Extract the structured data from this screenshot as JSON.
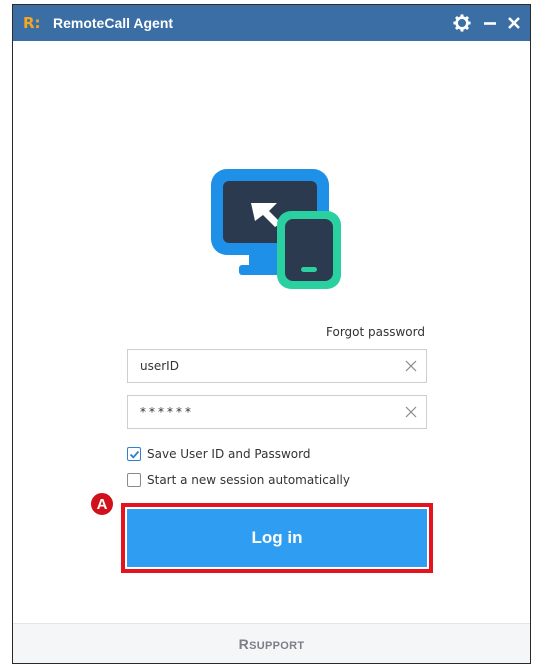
{
  "window": {
    "logo_text": "R:",
    "title": "RemoteCall Agent"
  },
  "icons": {
    "gear": "gear-icon",
    "minimize": "minimize-icon",
    "close": "close-icon",
    "clear": "clear-x-icon",
    "check": "checkmark-icon",
    "app": "remote-devices-icon"
  },
  "form": {
    "forgot_password": "Forgot password",
    "user_id_value": "userID",
    "password_value": "******",
    "save_credentials_label": "Save User ID and Password",
    "save_credentials_checked": true,
    "auto_session_label": "Start a new session automatically",
    "auto_session_checked": false,
    "login_label": "Log in"
  },
  "annotation": {
    "marker": "A"
  },
  "footer": {
    "brand_r": "R",
    "brand_rest": "SUPPORT"
  },
  "colors": {
    "titlebar": "#3a6ea5",
    "login_button": "#2f9ef2",
    "highlight": "#e5131d",
    "accent_green": "#2bd0a0"
  }
}
